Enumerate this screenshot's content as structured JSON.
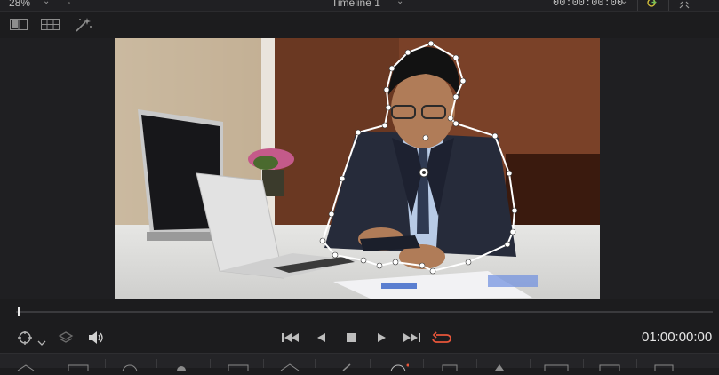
{
  "viewer_header": {
    "zoom": "28%",
    "timeline_name": "Timeline 1",
    "timecode": "00:00:00:00"
  },
  "transport": {
    "timecode": "01:00:00:00"
  },
  "colors": {
    "background": "#1c1c1e",
    "loop_active": "#e8563a",
    "mask_outline": "#ffffff"
  },
  "icons": {
    "viewer_mode": "split-view-icon",
    "grid": "grid-icon",
    "magic_mask": "magic-wand-icon",
    "tracker": "crosshair-icon",
    "layers": "layers-icon",
    "audio": "speaker-icon",
    "go_first": "skip-to-start-icon",
    "reverse": "play-reverse-icon",
    "stop": "stop-icon",
    "play": "play-icon",
    "go_last": "skip-to-end-icon",
    "loop": "loop-icon"
  }
}
